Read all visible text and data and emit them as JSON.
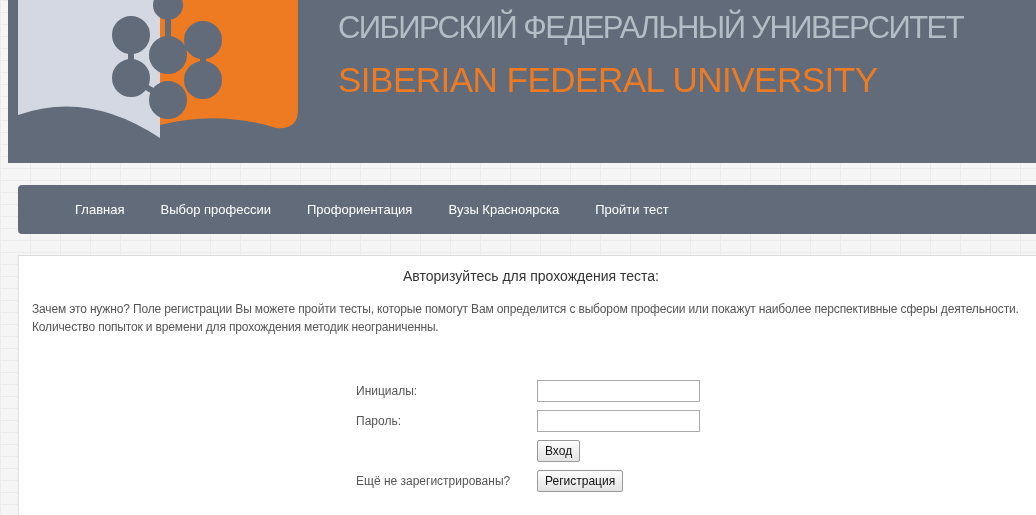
{
  "header": {
    "title_ru": "СИБИРСКИЙ ФЕДЕРАЛЬНЫЙ УНИВЕРСИТЕТ",
    "title_en": "SIBERIAN FEDERAL UNIVERSITY"
  },
  "nav": [
    {
      "label": "Главная"
    },
    {
      "label": "Выбор профессии"
    },
    {
      "label": "Профориентация"
    },
    {
      "label": "Вузы Красноярска"
    },
    {
      "label": "Пройти тест"
    }
  ],
  "auth": {
    "heading": "Авторизуйтесь для прохождения теста:",
    "description": "Зачем это нужно? Поле регистрации Вы можете пройти тесты, которые помогут Вам определится с выбором професии или покажут наиболее перспективные сферы деятельности. Количество попыток и времени для прохождения методик неограниченны.",
    "fields": [
      {
        "label": "Инициалы:"
      },
      {
        "label": "Пароль:"
      }
    ],
    "login_button": "Вход",
    "register_prompt": "Ещё не зарегистрированы?",
    "register_button": "Регистрация"
  }
}
